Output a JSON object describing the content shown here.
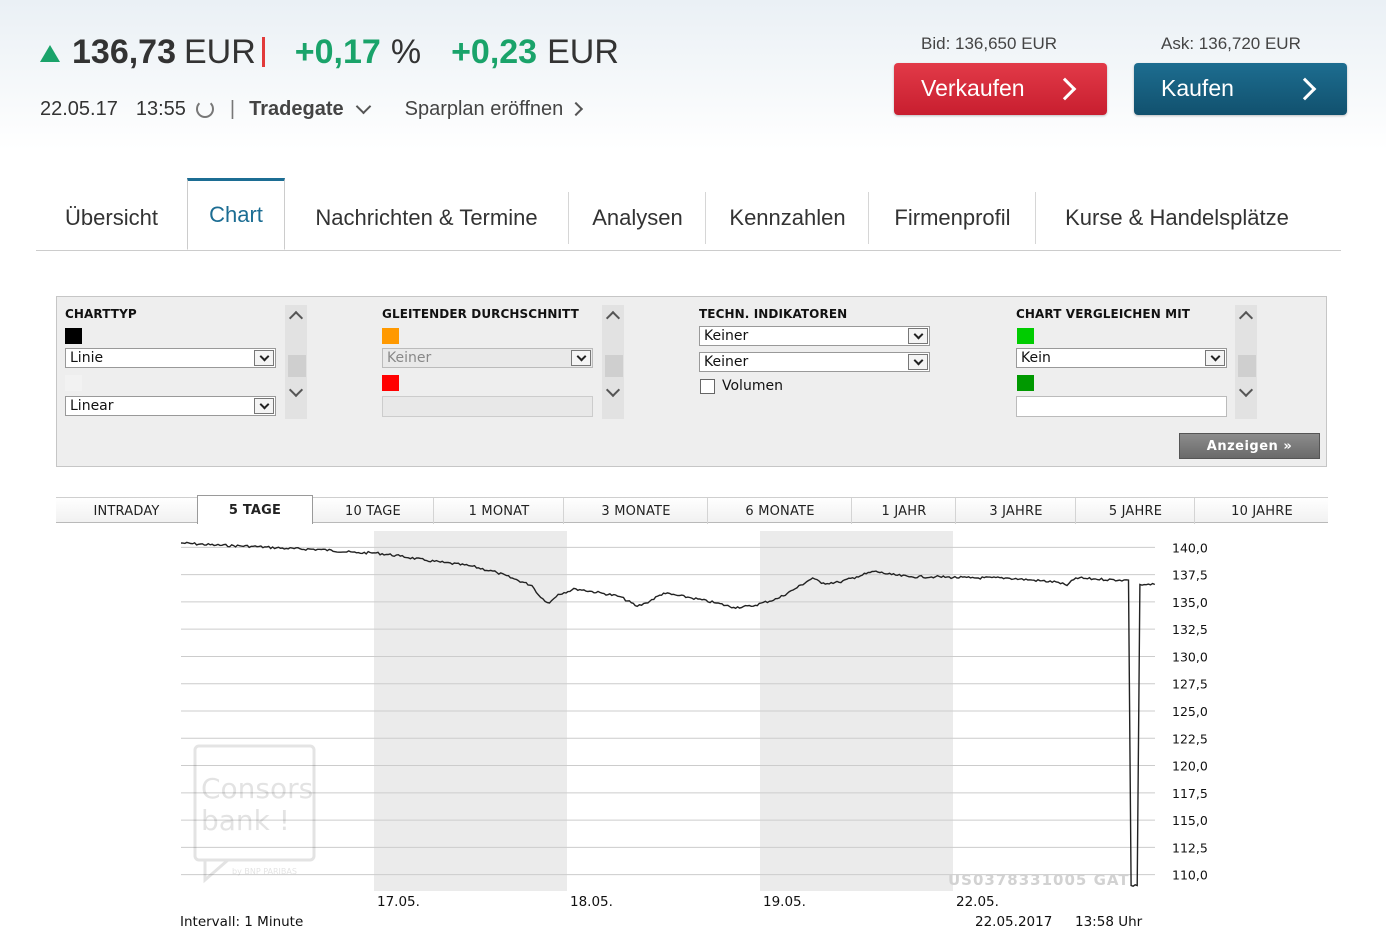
{
  "quote": {
    "price": "136,73",
    "currency": "EUR",
    "change_pct": "+0,17",
    "pct_unit": "%",
    "change_abs": "+0,23",
    "abs_unit": "EUR",
    "date": "22.05.17",
    "time": "13:55",
    "exchange": "Tradegate",
    "sparplan": "Sparplan eröffnen",
    "trend_color": "#1aa36a"
  },
  "trade": {
    "bid": "Bid: 136,650 EUR",
    "ask": "Ask: 136,720 EUR",
    "sell_label": "Verkaufen",
    "buy_label": "Kaufen",
    "sell_color": "#d42a3c",
    "buy_color": "#155f80"
  },
  "tabs": [
    "Übersicht",
    "Chart",
    "Nachrichten & Termine",
    "Analysen",
    "Kennzahlen",
    "Firmenprofil",
    "Kurse & Handelsplätze"
  ],
  "active_tab": "Chart",
  "chart_settings": {
    "charttyp": {
      "title": "CHARTTYP",
      "type": "Linie",
      "scale": "Linear"
    },
    "gd": {
      "title": "GLEITENDER DURCHSCHNITT",
      "value": "Keiner"
    },
    "indicators": {
      "title": "TECHN. INDIKATOREN",
      "ind1": "Keiner",
      "ind2": "Keiner",
      "volume_label": "Volumen",
      "volume_checked": false
    },
    "compare": {
      "title": "CHART VERGLEICHEN MIT",
      "value": "Kein"
    },
    "show_button": "Anzeigen »",
    "colors": {
      "line": "#000000",
      "gd1": "#ff9900",
      "gd2": "#ff0000",
      "cmp1": "#00cc00",
      "cmp2": "#009900"
    }
  },
  "ranges": [
    "INTRADAY",
    "5 TAGE",
    "10 TAGE",
    "1 MONAT",
    "3 MONATE",
    "6 MONATE",
    "1 JAHR",
    "3 JAHRE",
    "5 JAHRE",
    "10 JAHRE"
  ],
  "active_range": "5 TAGE",
  "chart_footer": {
    "interval": "Intervall: 1 Minute",
    "date": "22.05.2017",
    "time": "13:58 Uhr",
    "isin_label": "US0378331005 GAT"
  },
  "watermark": {
    "line1": "Consors",
    "line2": "bank !",
    "tagline": "by BNP PARIBAS"
  },
  "chart_data": {
    "type": "line",
    "x_labels": [
      "17.05.",
      "18.05.",
      "19.05.",
      "22.05."
    ],
    "y_ticks": [
      "140,0",
      "137,5",
      "135,0",
      "132,5",
      "130,0",
      "127,5",
      "125,0",
      "122,5",
      "120,0",
      "117,5",
      "115,0",
      "112,5",
      "110,0"
    ],
    "ylim": [
      108.5,
      141.5
    ],
    "grid": true,
    "shaded_days": [
      "17.05.",
      "19.05."
    ],
    "series": [
      {
        "values": [
          [
            0,
            140.4
          ],
          [
            4,
            140.2
          ],
          [
            8,
            140.1
          ],
          [
            12,
            139.9
          ],
          [
            16,
            139.8
          ],
          [
            20,
            139.5
          ],
          [
            22,
            139.5
          ],
          [
            25,
            139.2
          ],
          [
            28,
            138.8
          ],
          [
            30,
            138.6
          ],
          [
            33,
            138.3
          ],
          [
            36,
            137.7
          ],
          [
            38,
            137.1
          ],
          [
            40,
            136.5
          ],
          [
            41,
            135.4
          ],
          [
            42,
            134.9
          ],
          [
            43,
            135.7
          ],
          [
            45,
            136.2
          ],
          [
            48,
            135.8
          ],
          [
            50,
            135.5
          ],
          [
            52,
            134.6
          ],
          [
            53,
            134.9
          ],
          [
            55,
            135.8
          ],
          [
            58,
            135.4
          ],
          [
            61,
            134.9
          ],
          [
            63,
            134.5
          ],
          [
            65,
            134.6
          ],
          [
            68,
            135.3
          ],
          [
            70,
            136.2
          ],
          [
            72,
            137.2
          ],
          [
            73,
            136.7
          ],
          [
            75,
            136.8
          ],
          [
            77,
            137.3
          ],
          [
            79,
            137.8
          ],
          [
            81,
            137.5
          ],
          [
            83,
            137.3
          ],
          [
            86,
            137.3
          ],
          [
            90,
            137.2
          ],
          [
            94,
            137.2
          ],
          [
            97,
            137.0
          ],
          [
            100,
            136.8
          ],
          [
            101,
            136.5
          ],
          [
            102,
            137.2
          ],
          [
            104,
            137.1
          ],
          [
            107,
            137.0
          ],
          [
            108,
            137.0
          ],
          [
            108.3,
            109.0
          ],
          [
            109,
            109.0
          ],
          [
            109.3,
            136.6
          ],
          [
            111,
            136.6
          ]
        ]
      }
    ]
  }
}
